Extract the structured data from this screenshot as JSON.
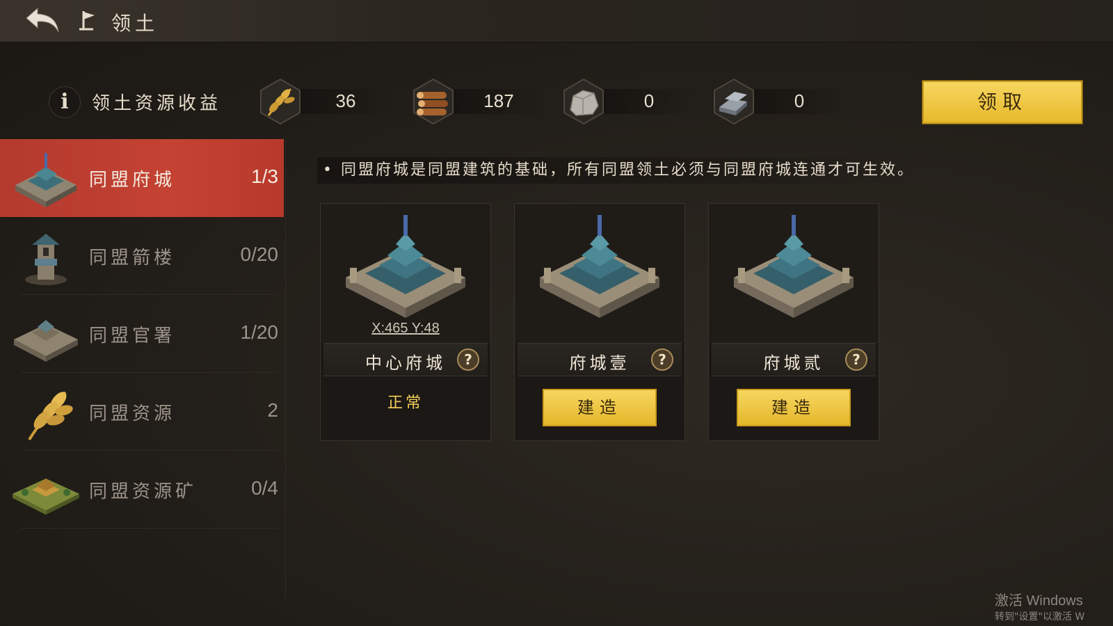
{
  "header": {
    "title": "领土",
    "back_icon": "back-arrow-icon",
    "flag_icon": "flag-icon"
  },
  "resources": {
    "title": "领土资源收益",
    "info_icon_label": "i",
    "items": [
      {
        "icon": "wheat-icon",
        "value": "36"
      },
      {
        "icon": "wood-icon",
        "value": "187"
      },
      {
        "icon": "stone-icon",
        "value": "0"
      },
      {
        "icon": "iron-icon",
        "value": "0"
      }
    ],
    "claim_label": "领取"
  },
  "sidebar": {
    "items": [
      {
        "label": "同盟府城",
        "count": "1/3",
        "icon": "alliance-city-icon",
        "active": true
      },
      {
        "label": "同盟箭楼",
        "count": "0/20",
        "icon": "arrow-tower-icon",
        "active": false
      },
      {
        "label": "同盟官署",
        "count": "1/20",
        "icon": "government-office-icon",
        "active": false
      },
      {
        "label": "同盟资源",
        "count": "2",
        "icon": "wheat-resource-icon",
        "active": false
      },
      {
        "label": "同盟资源矿",
        "count": "0/4",
        "icon": "resource-mine-icon",
        "active": false
      }
    ]
  },
  "main": {
    "description": "• 同盟府城是同盟建筑的基础，所有同盟领土必须与同盟府城连通才可生效。",
    "cards": [
      {
        "name": "中心府城",
        "coords": "X:465 Y:48",
        "status": "正常",
        "help": "?"
      },
      {
        "name": "府城壹",
        "button": "建造",
        "help": "?"
      },
      {
        "name": "府城贰",
        "button": "建造",
        "help": "?"
      }
    ]
  },
  "watermark": {
    "line1": "激活 Windows",
    "line2": "转到\"设置\"以激活 W"
  },
  "colors": {
    "accent_red": "#c44233",
    "button_gold": "#f0c944",
    "status_gold": "#f3cf5a"
  }
}
